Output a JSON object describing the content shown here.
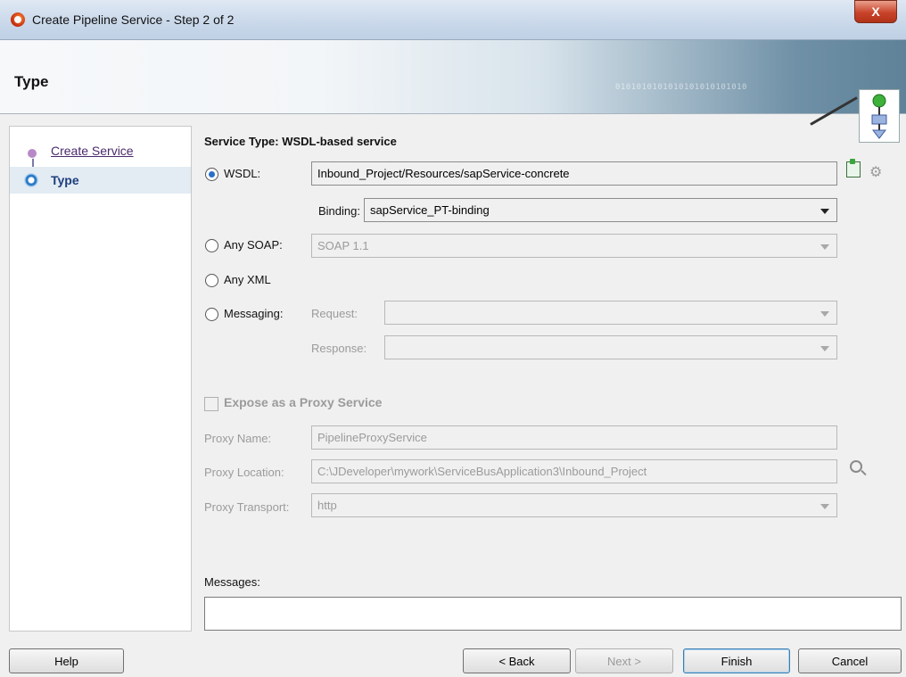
{
  "window": {
    "title": "Create Pipeline Service - Step 2 of 2",
    "close_label": "X"
  },
  "header": {
    "title": "Type",
    "binary_decor": "0101010101010101010101010"
  },
  "nav": {
    "items": [
      {
        "label": "Create Service"
      },
      {
        "label": "Type"
      }
    ]
  },
  "form": {
    "section_title": "Service Type: WSDL-based service",
    "wsdl": {
      "label": "WSDL:",
      "value": "Inbound_Project/Resources/sapService-concrete",
      "selected": true
    },
    "binding": {
      "label": "Binding:",
      "value": "sapService_PT-binding"
    },
    "any_soap": {
      "label": "Any SOAP:",
      "value": "SOAP 1.1"
    },
    "any_xml": {
      "label": "Any XML"
    },
    "messaging": {
      "label": "Messaging:",
      "request_label": "Request:",
      "request_value": "",
      "response_label": "Response:",
      "response_value": ""
    },
    "expose_proxy": {
      "label": "Expose as a Proxy Service",
      "checked": false
    },
    "proxy_name": {
      "label": "Proxy Name:",
      "value": "PipelineProxyService"
    },
    "proxy_location": {
      "label": "Proxy Location:",
      "value": "C:\\JDeveloper\\mywork\\ServiceBusApplication3\\Inbound_Project"
    },
    "proxy_transport": {
      "label": "Proxy Transport:",
      "value": "http"
    },
    "messages_label": "Messages:",
    "messages_value": ""
  },
  "buttons": {
    "help": "Help",
    "back": "< Back",
    "next": "Next >",
    "finish": "Finish",
    "cancel": "Cancel"
  }
}
